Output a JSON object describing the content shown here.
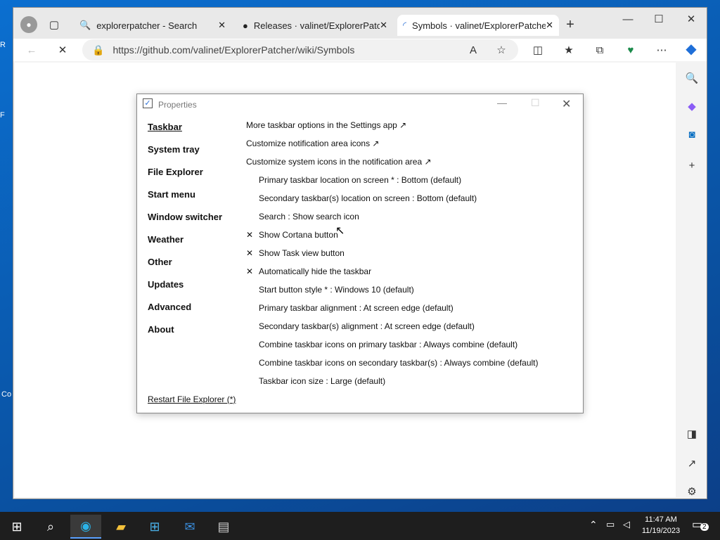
{
  "browser": {
    "tabs": [
      {
        "title": "explorerpatcher - Search"
      },
      {
        "title": "Releases · valinet/ExplorerPatcher"
      },
      {
        "title": "Symbols · valinet/ExplorerPatcher"
      }
    ],
    "url": "https://github.com/valinet/ExplorerPatcher/wiki/Symbols"
  },
  "dialog": {
    "title": "Properties",
    "nav": [
      "Taskbar",
      "System tray",
      "File Explorer",
      "Start menu",
      "Window switcher",
      "Weather",
      "Other",
      "Updates",
      "Advanced",
      "About"
    ],
    "restart": "Restart File Explorer (*)",
    "options": [
      {
        "text": "More taskbar options in the Settings app ↗"
      },
      {
        "text": "Customize notification area icons ↗"
      },
      {
        "text": "Customize system icons in the notification area ↗"
      },
      {
        "text": "Primary taskbar location on screen * : Bottom (default)"
      },
      {
        "text": "Secondary taskbar(s) location on screen : Bottom (default)"
      },
      {
        "text": "Search : Show search icon"
      },
      {
        "text": "Show Cortana button",
        "mark": "✕"
      },
      {
        "text": "Show Task view button",
        "mark": "✕"
      },
      {
        "text": "Automatically hide the taskbar",
        "mark": "✕"
      },
      {
        "text": "Start button style * : Windows 10 (default)"
      },
      {
        "text": "Primary taskbar alignment : At screen edge (default)"
      },
      {
        "text": "Secondary taskbar(s) alignment : At screen edge (default)"
      },
      {
        "text": "Combine taskbar icons on primary taskbar : Always combine (default)"
      },
      {
        "text": "Combine taskbar icons on secondary taskbar(s) : Always combine (default)"
      },
      {
        "text": "Taskbar icon size : Large (default)"
      }
    ]
  },
  "desktop": {
    "edge": [
      "R",
      "F",
      "Co"
    ]
  },
  "taskbar": {
    "time": "11:47 AM",
    "date": "11/19/2023",
    "badge": "2"
  }
}
